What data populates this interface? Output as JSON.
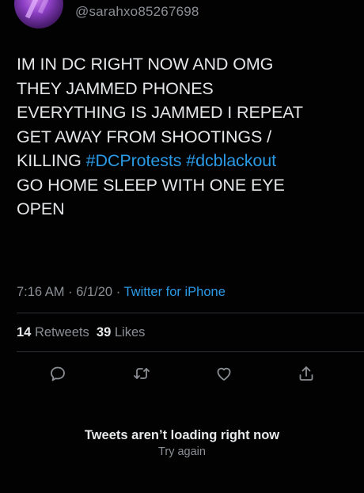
{
  "tweet": {
    "handle": "@sarahxo85267698",
    "text_lines": [
      {
        "plain": "IM IN DC RIGHT NOW AND OMG",
        "tags": []
      },
      {
        "plain": "THEY JAMMED PHONES",
        "tags": []
      },
      {
        "plain": "EVERYTHING IS JAMMED I REPEAT",
        "tags": []
      },
      {
        "plain": "GET AWAY FROM SHOOTINGS /",
        "tags": []
      },
      {
        "plain": "KILLING ",
        "tags": [
          "#DCProtests",
          "#dcblackout"
        ]
      },
      {
        "plain": "GO HOME SLEEP WITH ONE EYE",
        "tags": []
      },
      {
        "plain": "OPEN",
        "tags": []
      }
    ],
    "time": "7:16 AM",
    "date": "6/1/20",
    "separator": "·",
    "source": "Twitter for iPhone",
    "retweets_count": "14",
    "retweets_label": "Retweets",
    "likes_count": "39",
    "likes_label": "Likes"
  },
  "actions": [
    {
      "name": "reply-icon"
    },
    {
      "name": "retweet-icon"
    },
    {
      "name": "like-icon"
    },
    {
      "name": "share-icon"
    }
  ],
  "error": {
    "title": "Tweets aren’t loading right now",
    "retry": "Try again"
  },
  "colors": {
    "background": "#020203",
    "text": "#e4e6e8",
    "secondary": "#8b8f94",
    "accent": "#2b9ae6"
  }
}
